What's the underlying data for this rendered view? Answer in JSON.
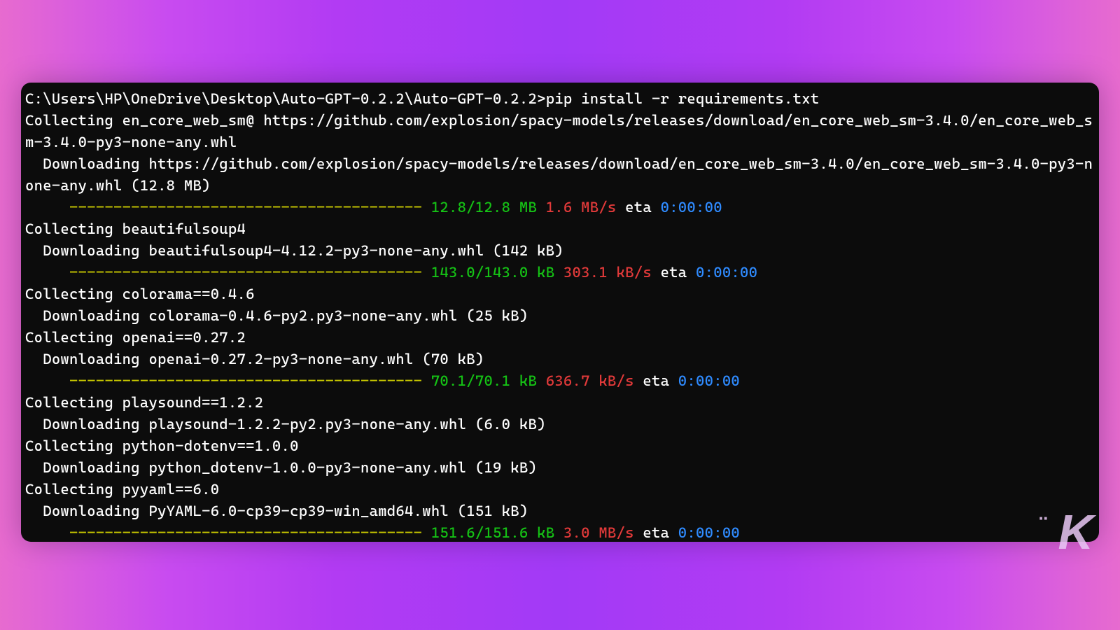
{
  "prompt": {
    "cwd": "C:\\Users\\HP\\OneDrive\\Desktop\\Auto-GPT-0.2.2\\Auto-GPT-0.2.2>",
    "cmd": "pip install -r requirements.txt"
  },
  "lines": {
    "l1": "Collecting en_core_web_sm@ https://github.com/explosion/spacy-models/releases/download/en_core_web_sm-3.4.0/en_core_web_sm-3.4.0-py3-none-any.whl",
    "l2": "  Downloading https://github.com/explosion/spacy-models/releases/download/en_core_web_sm-3.4.0/en_core_web_sm-3.4.0-py3-none-any.whl (12.8 MB)",
    "l3": "Collecting beautifulsoup4",
    "l4": "  Downloading beautifulsoup4-4.12.2-py3-none-any.whl (142 kB)",
    "l5": "Collecting colorama==0.4.6",
    "l6": "  Downloading colorama-0.4.6-py2.py3-none-any.whl (25 kB)",
    "l7": "Collecting openai==0.27.2",
    "l8": "  Downloading openai-0.27.2-py3-none-any.whl (70 kB)",
    "l9": "Collecting playsound==1.2.2",
    "l10": "  Downloading playsound-1.2.2-py2.py3-none-any.whl (6.0 kB)",
    "l11": "Collecting python-dotenv==1.0.0",
    "l12": "  Downloading python_dotenv-1.0.0-py3-none-any.whl (19 kB)",
    "l13": "Collecting pyyaml==6.0",
    "l14": "  Downloading PyYAML-6.0-cp39-cp39-win_amd64.whl (151 kB)"
  },
  "progress": {
    "dashes": "     ---------------------------------------- ",
    "p1": {
      "size": "12.8/12.8 MB",
      "speed": "1.6 MB/s",
      "eta_label": "eta",
      "eta": "0:00:00"
    },
    "p2": {
      "size": "143.0/143.0 kB",
      "speed": "303.1 kB/s",
      "eta_label": "eta",
      "eta": "0:00:00"
    },
    "p3": {
      "size": "70.1/70.1 kB",
      "speed": "636.7 kB/s",
      "eta_label": "eta",
      "eta": "0:00:00"
    },
    "p4": {
      "size": "151.6/151.6 kB",
      "speed": "3.0 MB/s",
      "eta_label": "eta",
      "eta": "0:00:00"
    }
  },
  "watermark": "K"
}
